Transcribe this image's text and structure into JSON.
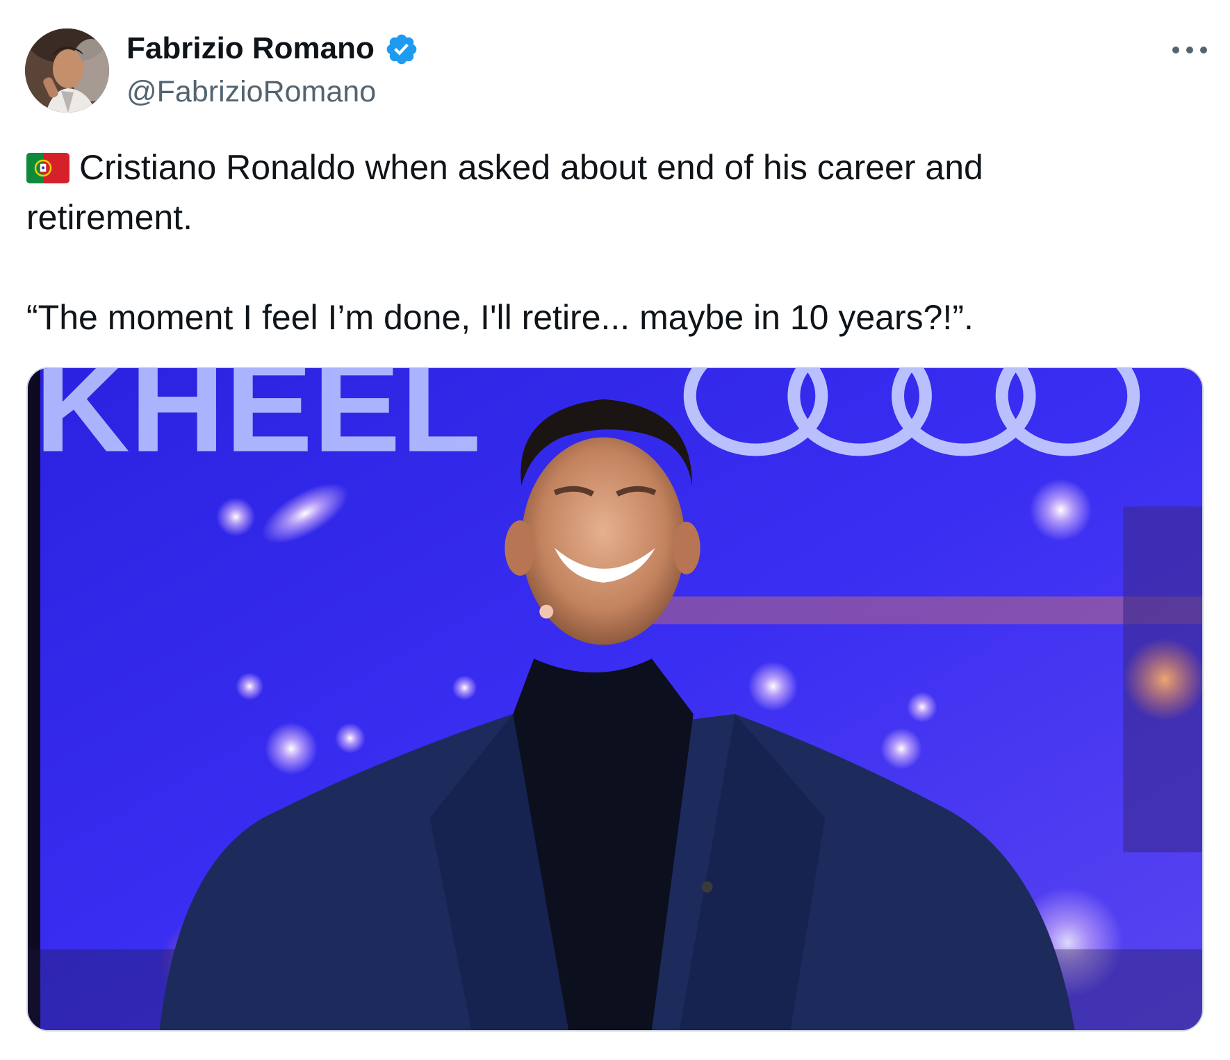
{
  "author": {
    "display_name": "Fabrizio Romano",
    "handle": "@FabrizioRomano",
    "verified": true,
    "avatar_icon": "profile-photo"
  },
  "menu": {
    "more_icon": "more-horizontal-icon"
  },
  "tweet": {
    "flag_icon": "portugal-flag-icon",
    "line1": "Cristiano Ronaldo when asked about end of his career and",
    "line2": "retirement.",
    "line3": "“The moment I feel I’m done, I'll retire... maybe in 10 years?!”."
  },
  "media": {
    "type": "photo",
    "background_sign_text": "KHEEL"
  },
  "colors": {
    "text_primary": "#0f1419",
    "text_secondary": "#536471",
    "verified_blue": "#1d9bf0",
    "media_border": "#cfd9de",
    "stage_blue": "#3b2ef0"
  }
}
